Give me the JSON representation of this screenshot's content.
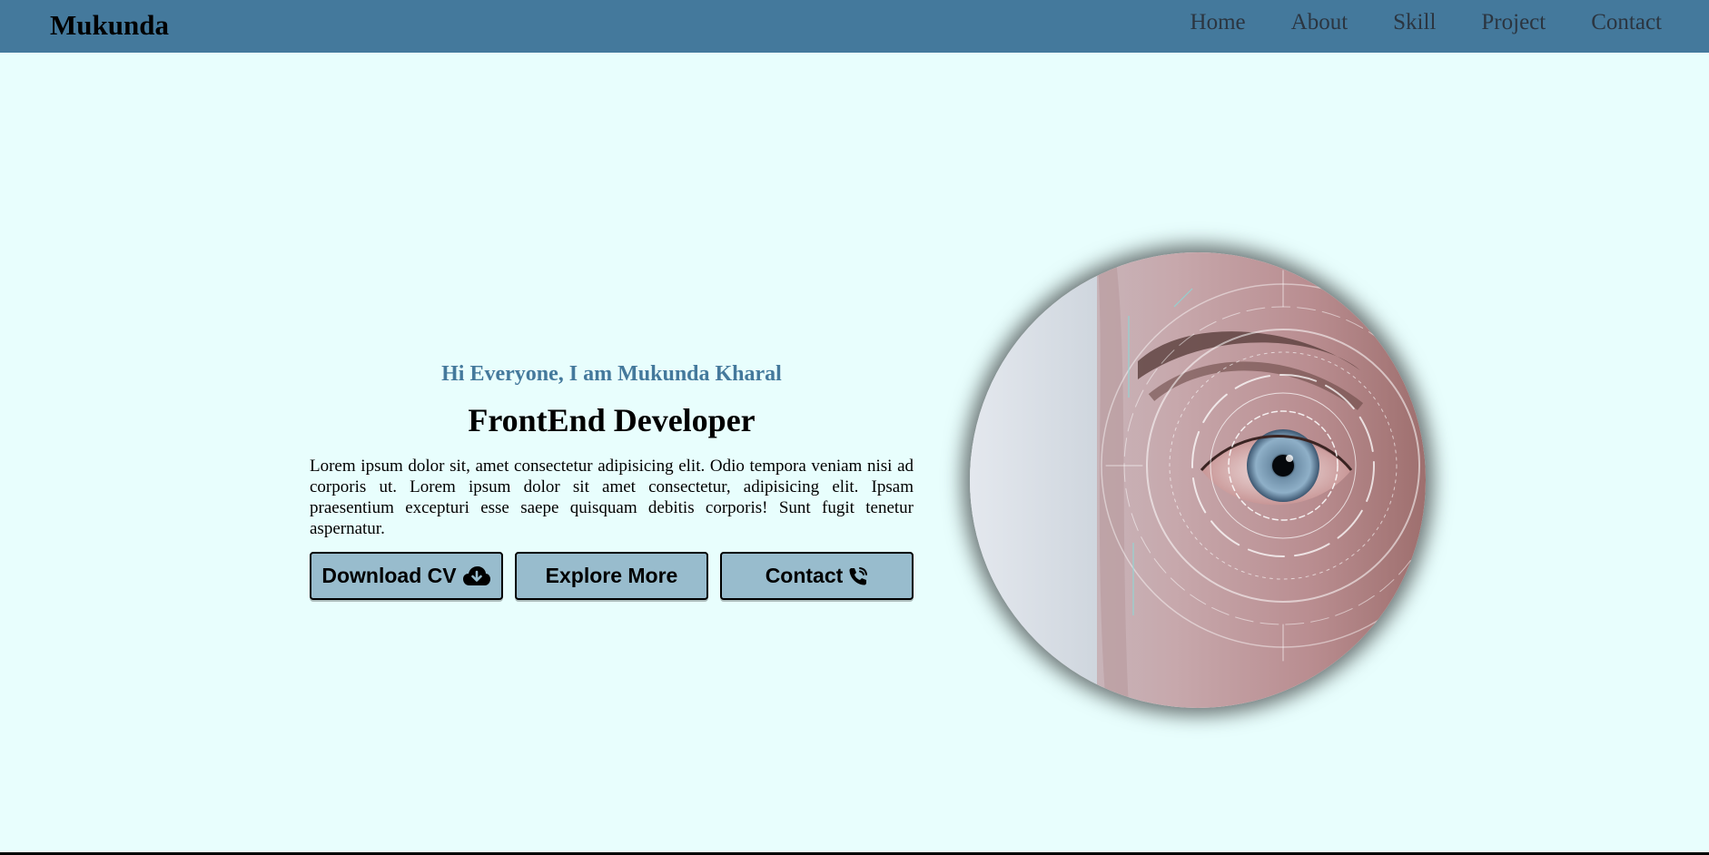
{
  "brand": "Mukunda",
  "nav": {
    "items": [
      "Home",
      "About",
      "Skill",
      "Project",
      "Contact"
    ]
  },
  "hero": {
    "greeting": "Hi Everyone, I am Mukunda Kharal",
    "role": "FrontEnd Developer",
    "intro": "Lorem ipsum dolor sit, amet consectetur adipisicing elit. Odio tempora veniam nisi ad corporis ut. Lorem ipsum dolor sit amet consectetur, adipisicing elit. Ipsam praesentium excepturi esse saepe quisquam debitis corporis! Sunt fugit tenetur aspernatur.",
    "buttons": {
      "download": {
        "label": "Download CV",
        "icon": "cloud-download-icon"
      },
      "explore": {
        "label": "Explore More"
      },
      "contact": {
        "label": "Contact",
        "icon": "phone-call-icon"
      }
    },
    "image": {
      "icon": "eye-scan-photo"
    }
  },
  "colors": {
    "navbar": "#44799c",
    "background": "#e8fefd",
    "button": "#98bccd",
    "accent": "#44799c"
  }
}
